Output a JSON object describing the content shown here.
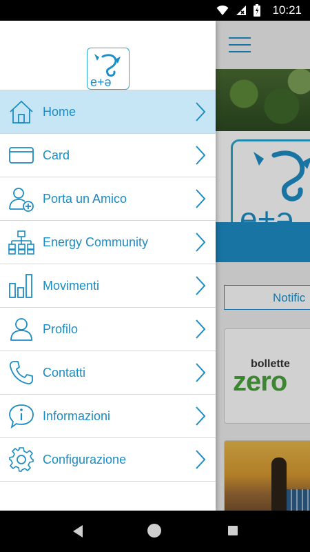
{
  "status_bar": {
    "time": "10:21"
  },
  "background": {
    "notification_button": "Notific",
    "promo_text_top": "bollette",
    "promo_text_main": "zero"
  },
  "drawer": {
    "logo_text": "e+ə",
    "items": [
      {
        "label": "Home",
        "icon": "home-icon",
        "active": true
      },
      {
        "label": "Card",
        "icon": "credit-card-icon",
        "active": false
      },
      {
        "label": "Porta un Amico",
        "icon": "add-user-icon",
        "active": false
      },
      {
        "label": "Energy Community",
        "icon": "org-chart-icon",
        "active": false
      },
      {
        "label": "Movimenti",
        "icon": "bar-chart-icon",
        "active": false
      },
      {
        "label": "Profilo",
        "icon": "user-icon",
        "active": false
      },
      {
        "label": "Contatti",
        "icon": "phone-icon",
        "active": false
      },
      {
        "label": "Informazioni",
        "icon": "info-icon",
        "active": false
      },
      {
        "label": "Configurazione",
        "icon": "gear-icon",
        "active": false
      }
    ]
  },
  "colors": {
    "accent": "#1b8cc3",
    "active_row": "#c6e6f5",
    "brand_blue": "#1d8ec7",
    "eco_green": "#4aa33c"
  }
}
